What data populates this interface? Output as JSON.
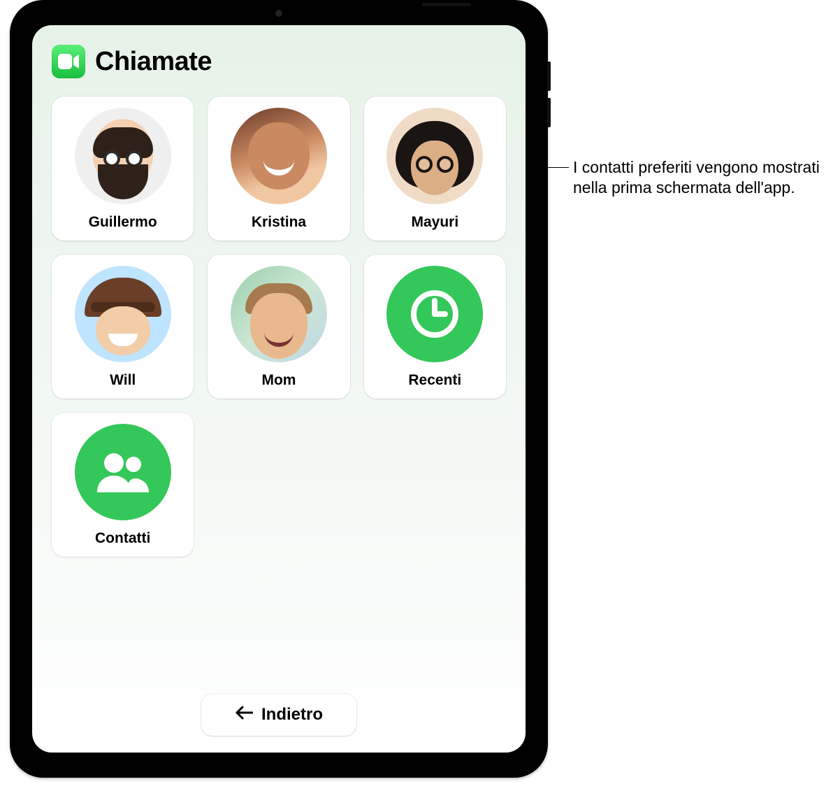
{
  "header": {
    "app_icon": "facetime-icon",
    "title": "Chiamate"
  },
  "tiles": [
    {
      "label": "Guillermo",
      "type": "contact"
    },
    {
      "label": "Kristina",
      "type": "contact"
    },
    {
      "label": "Mayuri",
      "type": "contact"
    },
    {
      "label": "Will",
      "type": "contact"
    },
    {
      "label": "Mom",
      "type": "contact"
    },
    {
      "label": "Recenti",
      "type": "recents",
      "icon": "clock-icon"
    },
    {
      "label": "Contatti",
      "type": "contacts",
      "icon": "people-icon"
    }
  ],
  "footer": {
    "back_label": "Indietro",
    "back_icon": "arrow-left-icon"
  },
  "callout": {
    "text": "I contatti preferiti vengono mostrati nella prima schermata dell'app."
  },
  "colors": {
    "accent_green": "#34c759",
    "screen_bg_top": "#e6f2e8"
  }
}
